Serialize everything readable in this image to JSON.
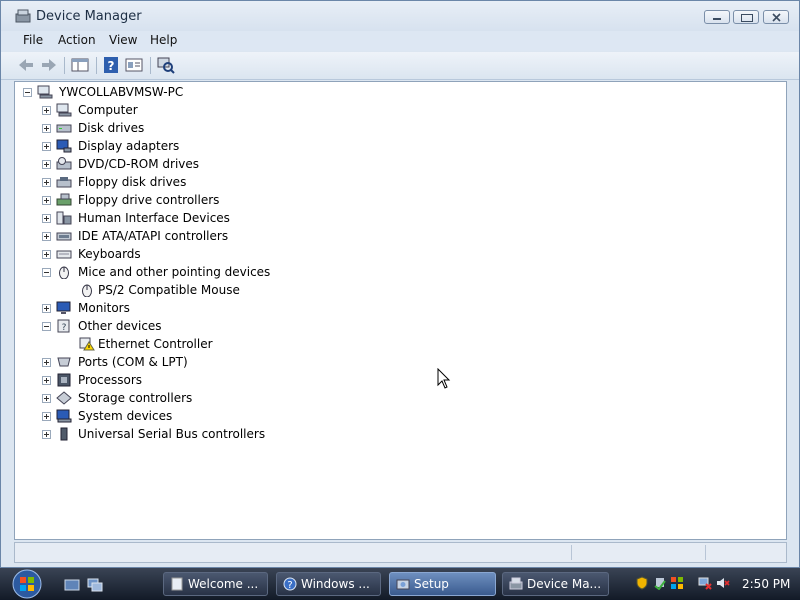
{
  "window": {
    "title": "Device Manager"
  },
  "menu": [
    "File",
    "Action",
    "View",
    "Help"
  ],
  "tree": {
    "root": "YWCOLLABVMSW-PC",
    "items": [
      {
        "label": "Computer",
        "state": "collapsed",
        "icon": "computer-icon"
      },
      {
        "label": "Disk drives",
        "state": "collapsed",
        "icon": "disk-drive-icon"
      },
      {
        "label": "Display adapters",
        "state": "collapsed",
        "icon": "display-adapter-icon"
      },
      {
        "label": "DVD/CD-ROM drives",
        "state": "collapsed",
        "icon": "dvd-drive-icon"
      },
      {
        "label": "Floppy disk drives",
        "state": "collapsed",
        "icon": "floppy-drive-icon"
      },
      {
        "label": "Floppy drive controllers",
        "state": "collapsed",
        "icon": "floppy-controller-icon"
      },
      {
        "label": "Human Interface Devices",
        "state": "collapsed",
        "icon": "hid-icon"
      },
      {
        "label": "IDE ATA/ATAPI controllers",
        "state": "collapsed",
        "icon": "ide-controller-icon"
      },
      {
        "label": "Keyboards",
        "state": "collapsed",
        "icon": "keyboard-icon"
      },
      {
        "label": "Mice and other pointing devices",
        "state": "expanded",
        "icon": "mouse-icon"
      },
      {
        "label": "PS/2 Compatible Mouse",
        "state": "child",
        "icon": "mouse-icon"
      },
      {
        "label": "Monitors",
        "state": "collapsed",
        "icon": "monitor-icon"
      },
      {
        "label": "Other devices",
        "state": "expanded",
        "icon": "unknown-device-icon"
      },
      {
        "label": "Ethernet Controller",
        "state": "child",
        "icon": "warning-device-icon"
      },
      {
        "label": "Ports (COM & LPT)",
        "state": "collapsed",
        "icon": "port-icon"
      },
      {
        "label": "Processors",
        "state": "collapsed",
        "icon": "processor-icon"
      },
      {
        "label": "Storage controllers",
        "state": "collapsed",
        "icon": "storage-controller-icon"
      },
      {
        "label": "System devices",
        "state": "collapsed",
        "icon": "system-device-icon"
      },
      {
        "label": "Universal Serial Bus controllers",
        "state": "collapsed",
        "icon": "usb-icon"
      }
    ]
  },
  "taskbar": {
    "tasks": [
      {
        "label": "Welcome ...",
        "icon": "document-icon",
        "active": false
      },
      {
        "label": "Windows ...",
        "icon": "help-icon",
        "active": false
      },
      {
        "label": "Setup",
        "icon": "setup-icon",
        "active": true
      },
      {
        "label": "Device Ma...",
        "icon": "device-manager-icon",
        "active": false
      }
    ],
    "clock": "2:50 PM"
  }
}
